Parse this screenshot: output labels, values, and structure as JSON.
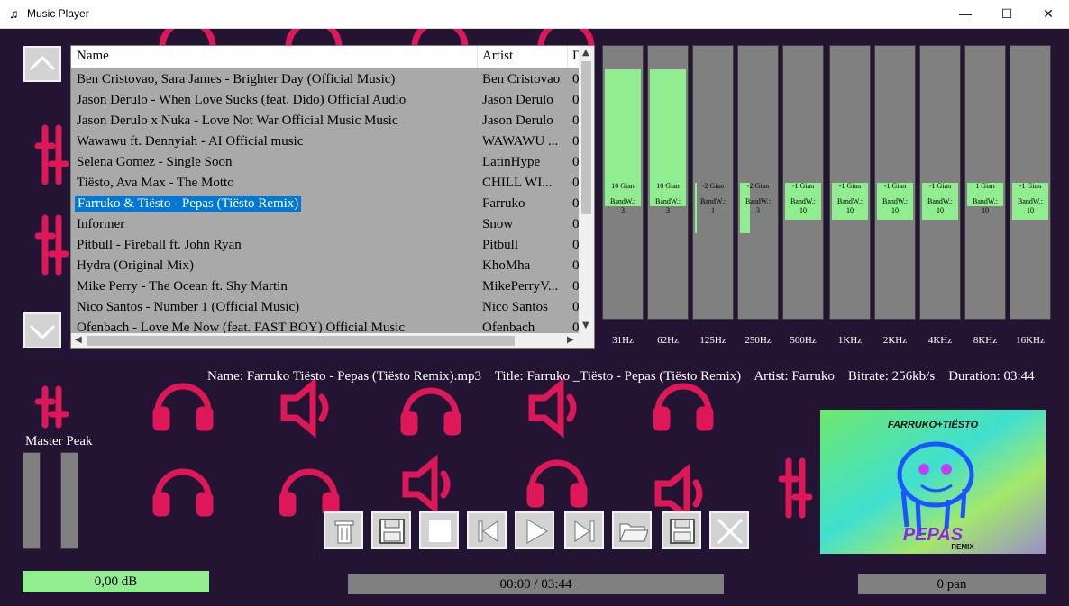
{
  "window": {
    "title": "Music Player"
  },
  "playlist": {
    "columns": [
      "Name",
      "Artist",
      "D"
    ],
    "rows": [
      {
        "name": "Ben Cristovao, Sara James - Brighter Day (Official Music)",
        "artist": "Ben Cristovao",
        "d": "0"
      },
      {
        "name": "Jason Derulo - When Love Sucks (feat. Dido) Official Audio",
        "artist": "Jason Derulo",
        "d": "0"
      },
      {
        "name": "Jason Derulo x Nuka - Love Not War Official Music Music",
        "artist": "Jason Derulo",
        "d": "0"
      },
      {
        "name": "Wawawu ft. Dennyiah - AI Official music",
        "artist": "WAWAWU ...",
        "d": "0"
      },
      {
        "name": "Selena Gomez - Single Soon",
        "artist": "LatinHype",
        "d": "0"
      },
      {
        "name": "Tiësto, Ava Max - The Motto",
        "artist": "CHILL WI...",
        "d": "0"
      },
      {
        "name": "Farruko & Tiësto - Pepas (Tiësto Remix)",
        "artist": "Farruko",
        "d": "0"
      },
      {
        "name": "Informer",
        "artist": "Snow",
        "d": "0"
      },
      {
        "name": "Pitbull - Fireball ft. John Ryan",
        "artist": "Pitbull",
        "d": "0"
      },
      {
        "name": "Hydra (Original Mix)",
        "artist": "KhoMha",
        "d": "0"
      },
      {
        "name": "Mike Perry - The Ocean ft. Shy Martin",
        "artist": "MikePerryV...",
        "d": "0"
      },
      {
        "name": "Nico Santos - Number 1 (Official Music)",
        "artist": "Nico Santos",
        "d": "0"
      },
      {
        "name": "Ofenbach - Love Me Now (feat. FAST BOY) Official Music",
        "artist": "Ofenbach",
        "d": "0"
      }
    ],
    "selected_index": 6
  },
  "equalizer": {
    "bands": [
      {
        "freq": "31Hz",
        "gain_text": "10 Gian",
        "bw_label": "BandW.:",
        "bw": "3",
        "gain_fraction": 1.0
      },
      {
        "freq": "62Hz",
        "gain_text": "10 Gian",
        "bw_label": "BandW.:",
        "bw": "3",
        "gain_fraction": 1.0
      },
      {
        "freq": "125Hz",
        "gain_text": "-2 Gian",
        "bw_label": "BandW.:",
        "bw": "1",
        "gain_fraction": -0.2
      },
      {
        "freq": "250Hz",
        "gain_text": "-2 Gian",
        "bw_label": "BandW.:",
        "bw": "3",
        "gain_fraction": -0.2
      },
      {
        "freq": "500Hz",
        "gain_text": "-1 Gian",
        "bw_label": "BandW.:",
        "bw": "10",
        "gain_fraction": -0.1
      },
      {
        "freq": "1KHz",
        "gain_text": "-1 Gian",
        "bw_label": "BandW.:",
        "bw": "10",
        "gain_fraction": -0.1
      },
      {
        "freq": "2KHz",
        "gain_text": "-1 Gian",
        "bw_label": "BandW.:",
        "bw": "10",
        "gain_fraction": -0.1
      },
      {
        "freq": "4KHz",
        "gain_text": "-1 Gian",
        "bw_label": "BandW.:",
        "bw": "10",
        "gain_fraction": -0.1
      },
      {
        "freq": "8KHz",
        "gain_text": "1 Gian",
        "bw_label": "BandW.:",
        "bw": "10",
        "gain_fraction": 0.1
      },
      {
        "freq": "16KHz",
        "gain_text": "-1 Gian",
        "bw_label": "BandW.:",
        "bw": "10",
        "gain_fraction": -0.1
      }
    ]
  },
  "track_info": {
    "name_label": "Name:",
    "name": "Farruko  Tiësto - Pepas (Tiësto Remix).mp3",
    "title_label": "Title:",
    "title": "Farruko _Tiësto - Pepas (Tiësto Remix)",
    "artist_label": "Artist:",
    "artist": "Farruko",
    "bitrate_label": "Bitrate:",
    "bitrate": "256kb/s",
    "duration_label": "Duration:",
    "duration": "03:44"
  },
  "master": {
    "label": "Master Peak",
    "db": "0,00 dB",
    "left_level": 0.0,
    "right_level": 0.0
  },
  "transport": {
    "position": "00:00 / 03:44",
    "pan": "0 pan",
    "buttons": [
      "trash-icon",
      "save-icon",
      "stop-icon",
      "previous-icon",
      "play-icon",
      "next-icon",
      "open-folder-icon",
      "save-playlist-icon",
      "close-icon"
    ]
  },
  "album_art": {
    "top_text": "FARRUKO+TIËSTO",
    "title": "PEPAS",
    "subtitle": "REMIX"
  },
  "colors": {
    "background": "#241433",
    "accent": "#e8195a",
    "eq_fill": "#90ee90",
    "selection": "#0078d7"
  }
}
